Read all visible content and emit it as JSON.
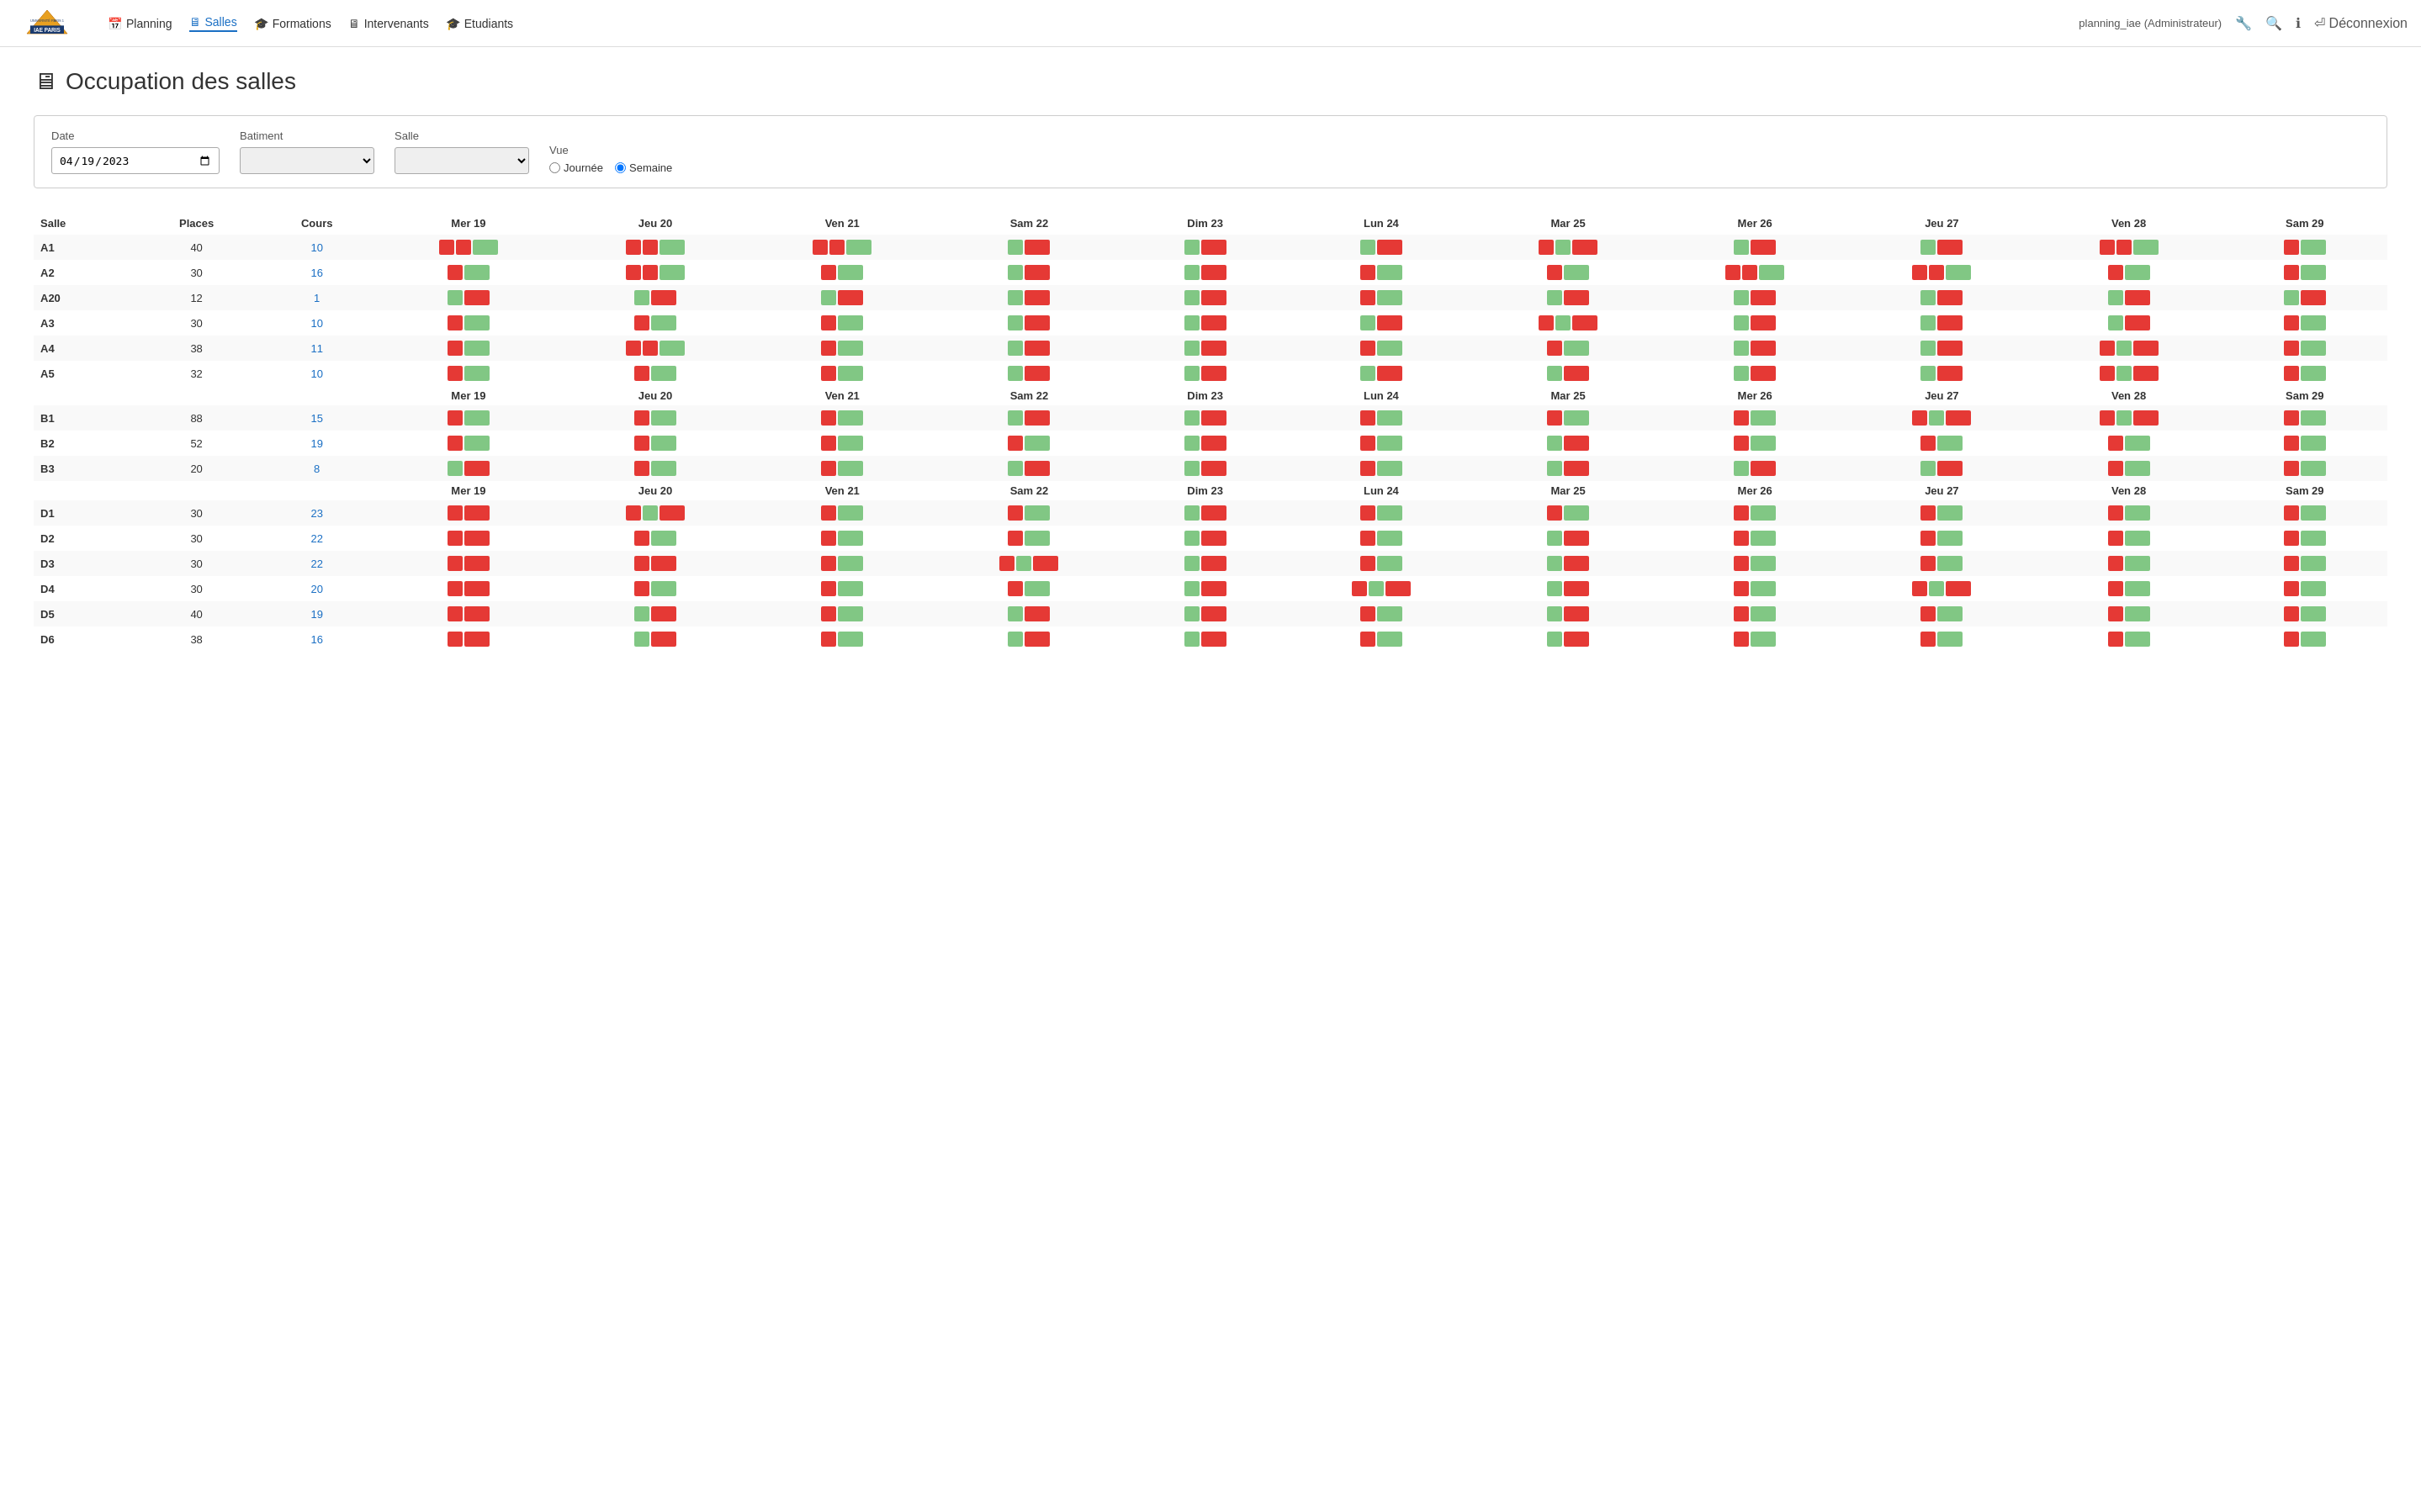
{
  "nav": {
    "logo_text": "IAE PARIS",
    "links": [
      {
        "label": "Planning",
        "icon": "📅",
        "active": false
      },
      {
        "label": "Salles",
        "icon": "🖥",
        "active": true
      },
      {
        "label": "Formations",
        "icon": "🎓",
        "active": false
      },
      {
        "label": "Intervenants",
        "icon": "🖥",
        "active": false
      },
      {
        "label": "Etudiants",
        "icon": "🎓",
        "active": false
      }
    ],
    "user": "planning_iae (Administrateur)",
    "icons": [
      "🔧",
      "🔍",
      "ℹ",
      "⏎"
    ],
    "deconnexion": "Déconnexion"
  },
  "page": {
    "title": "Occupation des salles",
    "title_icon": "🖥"
  },
  "filters": {
    "date_label": "Date",
    "date_value": "19/04/2023",
    "batiment_label": "Batiment",
    "salle_label": "Salle",
    "vue_label": "Vue",
    "vue_options": [
      "Journée",
      "Semaine"
    ],
    "vue_selected": "Semaine"
  },
  "table": {
    "headers": [
      "Salle",
      "Places",
      "Cours",
      "Mer 19",
      "Jeu 20",
      "Ven 21",
      "Sam 22",
      "Dim 23",
      "Lun 24",
      "Mar 25",
      "Mer 26",
      "Jeu 27",
      "Ven 28",
      "Sam 29"
    ],
    "sections": [
      {
        "id": "A",
        "rows": [
          {
            "salle": "A1",
            "places": 40,
            "cours": 10,
            "days": [
              [
                1,
                1,
                0,
                1
              ],
              [
                1,
                0,
                0,
                1
              ],
              [
                1,
                0,
                0,
                1
              ],
              [
                0,
                1
              ],
              [
                0,
                1
              ],
              [
                1,
                0,
                0,
                1
              ],
              [
                1,
                0,
                0,
                1
              ],
              [
                1,
                0,
                0,
                1
              ],
              [
                0,
                1
              ],
              [
                1,
                0,
                0,
                1
              ],
              [
                1,
                0
              ]
            ]
          },
          {
            "salle": "A2",
            "places": 30,
            "cours": 16,
            "days": [
              [
                1,
                0
              ],
              [
                1,
                0
              ],
              [
                1,
                0
              ],
              [
                0,
                1
              ],
              [
                0,
                1
              ],
              [
                1,
                0
              ],
              [
                1,
                0
              ],
              [
                1,
                0
              ],
              [
                1,
                0
              ],
              [
                1,
                0
              ],
              [
                1,
                0
              ]
            ]
          },
          {
            "salle": "A20",
            "places": 12,
            "cours": 1,
            "days": [
              [
                0,
                1
              ],
              [
                0,
                1
              ],
              [
                0,
                1
              ],
              [
                0,
                1
              ],
              [
                0,
                1
              ],
              [
                1,
                0
              ],
              [
                0,
                1
              ],
              [
                0,
                1
              ],
              [
                0,
                1
              ],
              [
                0,
                1
              ],
              [
                0,
                1
              ]
            ]
          },
          {
            "salle": "A3",
            "places": 30,
            "cours": 10,
            "days": [
              [
                1,
                0
              ],
              [
                1,
                0
              ],
              [
                1,
                0
              ],
              [
                0,
                1
              ],
              [
                0,
                1
              ],
              [
                0,
                1
              ],
              [
                1,
                0,
                1
              ],
              [
                0,
                1
              ],
              [
                0,
                1
              ],
              [
                0,
                1
              ],
              [
                1,
                0
              ]
            ]
          },
          {
            "salle": "A4",
            "places": 38,
            "cours": 11,
            "days": [
              [
                1,
                0
              ],
              [
                1,
                0
              ],
              [
                1,
                0
              ],
              [
                0,
                1
              ],
              [
                0,
                1
              ],
              [
                1,
                0
              ],
              [
                1,
                0
              ],
              [
                0,
                1
              ],
              [
                0,
                1
              ],
              [
                1,
                0
              ],
              [
                1,
                0
              ]
            ]
          },
          {
            "salle": "A5",
            "places": 32,
            "cours": 10,
            "days": [
              [
                1,
                0
              ],
              [
                1,
                0
              ],
              [
                1,
                0
              ],
              [
                0,
                1
              ],
              [
                0,
                1
              ],
              [
                0,
                1
              ],
              [
                0,
                1
              ],
              [
                0,
                1
              ],
              [
                0,
                1
              ],
              [
                1,
                0
              ],
              [
                1,
                0
              ]
            ]
          }
        ]
      },
      {
        "id": "B",
        "rows": [
          {
            "salle": "B1",
            "places": 88,
            "cours": 15,
            "days": [
              [
                1,
                0
              ],
              [
                1,
                0
              ],
              [
                1,
                0
              ],
              [
                0,
                1
              ],
              [
                0,
                1
              ],
              [
                1,
                0
              ],
              [
                1,
                0
              ],
              [
                1,
                0
              ],
              [
                1,
                0,
                1
              ],
              [
                1,
                0,
                1
              ],
              [
                1,
                0
              ]
            ]
          },
          {
            "salle": "B2",
            "places": 52,
            "cours": 19,
            "days": [
              [
                1,
                0
              ],
              [
                1,
                0
              ],
              [
                1,
                0
              ],
              [
                1,
                0
              ],
              [
                0,
                1
              ],
              [
                1,
                0
              ],
              [
                0,
                1
              ],
              [
                1,
                0
              ],
              [
                1,
                0
              ],
              [
                1,
                0
              ],
              [
                1,
                0
              ]
            ]
          },
          {
            "salle": "B3",
            "places": 20,
            "cours": 8,
            "days": [
              [
                0,
                1
              ],
              [
                1,
                0
              ],
              [
                1,
                0
              ],
              [
                0,
                1
              ],
              [
                0,
                1
              ],
              [
                1,
                0
              ],
              [
                0,
                1
              ],
              [
                0,
                1
              ],
              [
                0,
                1
              ],
              [
                1,
                0
              ],
              [
                1,
                0
              ]
            ]
          }
        ]
      },
      {
        "id": "D",
        "rows": [
          {
            "salle": "D1",
            "places": 30,
            "cours": 23,
            "days": [
              [
                1,
                1
              ],
              [
                1,
                0
              ],
              [
                1,
                0
              ],
              [
                1,
                0
              ],
              [
                0,
                1
              ],
              [
                1,
                0
              ],
              [
                1,
                0
              ],
              [
                1,
                0
              ],
              [
                1,
                0
              ],
              [
                1,
                0
              ],
              [
                1,
                0
              ]
            ]
          },
          {
            "salle": "D2",
            "places": 30,
            "cours": 22,
            "days": [
              [
                1,
                1
              ],
              [
                1,
                0
              ],
              [
                1,
                0
              ],
              [
                1,
                0
              ],
              [
                0,
                1
              ],
              [
                1,
                0
              ],
              [
                0,
                1
              ],
              [
                1,
                0
              ],
              [
                1,
                0
              ],
              [
                1,
                0
              ],
              [
                1,
                0
              ]
            ]
          },
          {
            "salle": "D3",
            "places": 30,
            "cours": 22,
            "days": [
              [
                1,
                1
              ],
              [
                1,
                1
              ],
              [
                1,
                0
              ],
              [
                1,
                0
              ],
              [
                0,
                1
              ],
              [
                1,
                0
              ],
              [
                0,
                1
              ],
              [
                1,
                0
              ],
              [
                1,
                0
              ],
              [
                1,
                0
              ],
              [
                1,
                0
              ]
            ]
          },
          {
            "salle": "D4",
            "places": 30,
            "cours": 20,
            "days": [
              [
                1,
                1
              ],
              [
                1,
                0
              ],
              [
                1,
                0
              ],
              [
                1,
                0
              ],
              [
                0,
                1
              ],
              [
                1,
                0
              ],
              [
                0,
                1
              ],
              [
                1,
                0
              ],
              [
                1,
                0
              ],
              [
                1,
                0
              ],
              [
                1,
                0
              ]
            ]
          },
          {
            "salle": "D5",
            "places": 40,
            "cours": 19,
            "days": [
              [
                1,
                1
              ],
              [
                0,
                1
              ],
              [
                1,
                0
              ],
              [
                0,
                1
              ],
              [
                0,
                1
              ],
              [
                1,
                0
              ],
              [
                0,
                1
              ],
              [
                1,
                0
              ],
              [
                1,
                0
              ],
              [
                1,
                0
              ],
              [
                1,
                0
              ]
            ]
          },
          {
            "salle": "D6",
            "places": 38,
            "cours": 16,
            "days": [
              [
                1,
                1
              ],
              [
                0,
                1
              ],
              [
                1,
                0
              ],
              [
                0,
                1
              ],
              [
                0,
                1
              ],
              [
                1,
                0
              ],
              [
                0,
                1
              ],
              [
                1,
                0
              ],
              [
                1,
                0
              ],
              [
                1,
                0
              ],
              [
                1,
                0
              ]
            ]
          }
        ]
      }
    ]
  }
}
